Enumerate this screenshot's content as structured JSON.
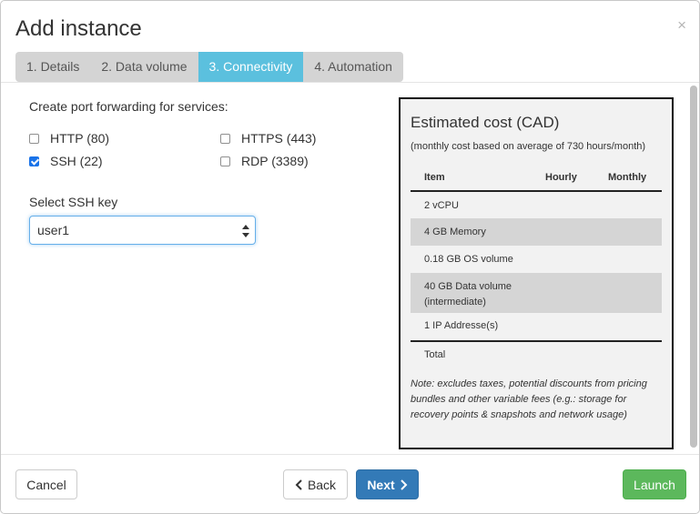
{
  "dialog": {
    "title": "Add instance",
    "close_symbol": "×"
  },
  "tabs": [
    {
      "label": "1. Details",
      "active": false
    },
    {
      "label": "2. Data volume",
      "active": false
    },
    {
      "label": "3. Connectivity",
      "active": true
    },
    {
      "label": "4. Automation",
      "active": false
    }
  ],
  "connectivity": {
    "services_label": "Create port forwarding for services:",
    "services": [
      {
        "label": "HTTP (80)",
        "checked": false
      },
      {
        "label": "HTTPS (443)",
        "checked": false
      },
      {
        "label": "SSH (22)",
        "checked": true
      },
      {
        "label": "RDP (3389)",
        "checked": false
      }
    ],
    "ssh_key_label": "Select SSH key",
    "ssh_key_value": "user1"
  },
  "cost": {
    "title": "Estimated cost (CAD)",
    "subtitle": "(monthly cost based on average of 730 hours/month)",
    "headers": {
      "item": "Item",
      "hourly": "Hourly",
      "monthly": "Monthly"
    },
    "rows": [
      {
        "item": "2 vCPU",
        "hourly": "",
        "monthly": ""
      },
      {
        "item": "4 GB Memory",
        "hourly": "",
        "monthly": ""
      },
      {
        "item": "0.18 GB OS volume",
        "hourly": "",
        "monthly": ""
      },
      {
        "item_line1": "40 GB Data volume",
        "item_line2": "(intermediate)",
        "hourly": "",
        "monthly": ""
      },
      {
        "item": "1 IP Addresse(s)",
        "hourly": "",
        "monthly": ""
      }
    ],
    "total_label": "Total",
    "note": "Note: excludes taxes, potential discounts from pricing bundles and other variable fees (e.g.: storage for recovery points & snapshots and network usage)"
  },
  "footer": {
    "cancel_label": "Cancel",
    "back_label": "Back",
    "next_label": "Next",
    "launch_label": "Launch"
  },
  "colors": {
    "active_tab": "#5bc0de",
    "primary": "#337ab7",
    "success": "#5cb85c"
  }
}
